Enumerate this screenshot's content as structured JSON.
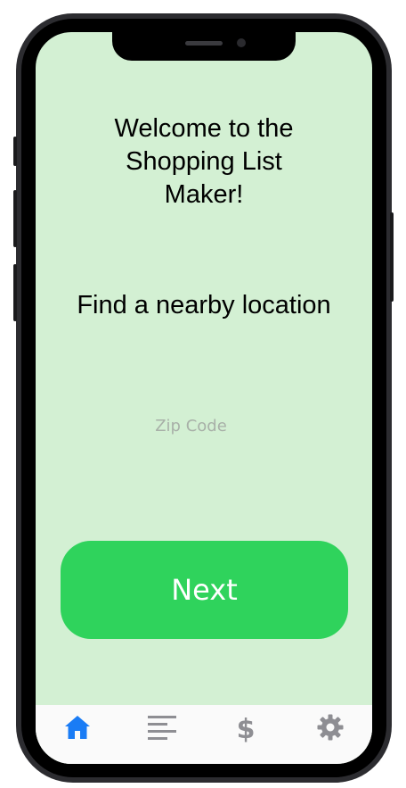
{
  "app": {
    "welcome_text": "Welcome to the\nShopping List\nMaker!",
    "find_text": "Find a nearby location"
  },
  "form": {
    "zip_placeholder": "Zip Code",
    "zip_value": ""
  },
  "actions": {
    "next_label": "Next"
  },
  "tabbar": {
    "tabs": [
      {
        "icon": "home-icon",
        "active": true
      },
      {
        "icon": "list-icon",
        "active": false
      },
      {
        "icon": "dollar-icon",
        "active": false
      },
      {
        "icon": "gear-icon",
        "active": false
      }
    ],
    "active_color": "#1a7cf5",
    "inactive_color": "#8e8e93"
  },
  "theme": {
    "background": "#d3f0d3",
    "button_color": "#2fd35c"
  }
}
